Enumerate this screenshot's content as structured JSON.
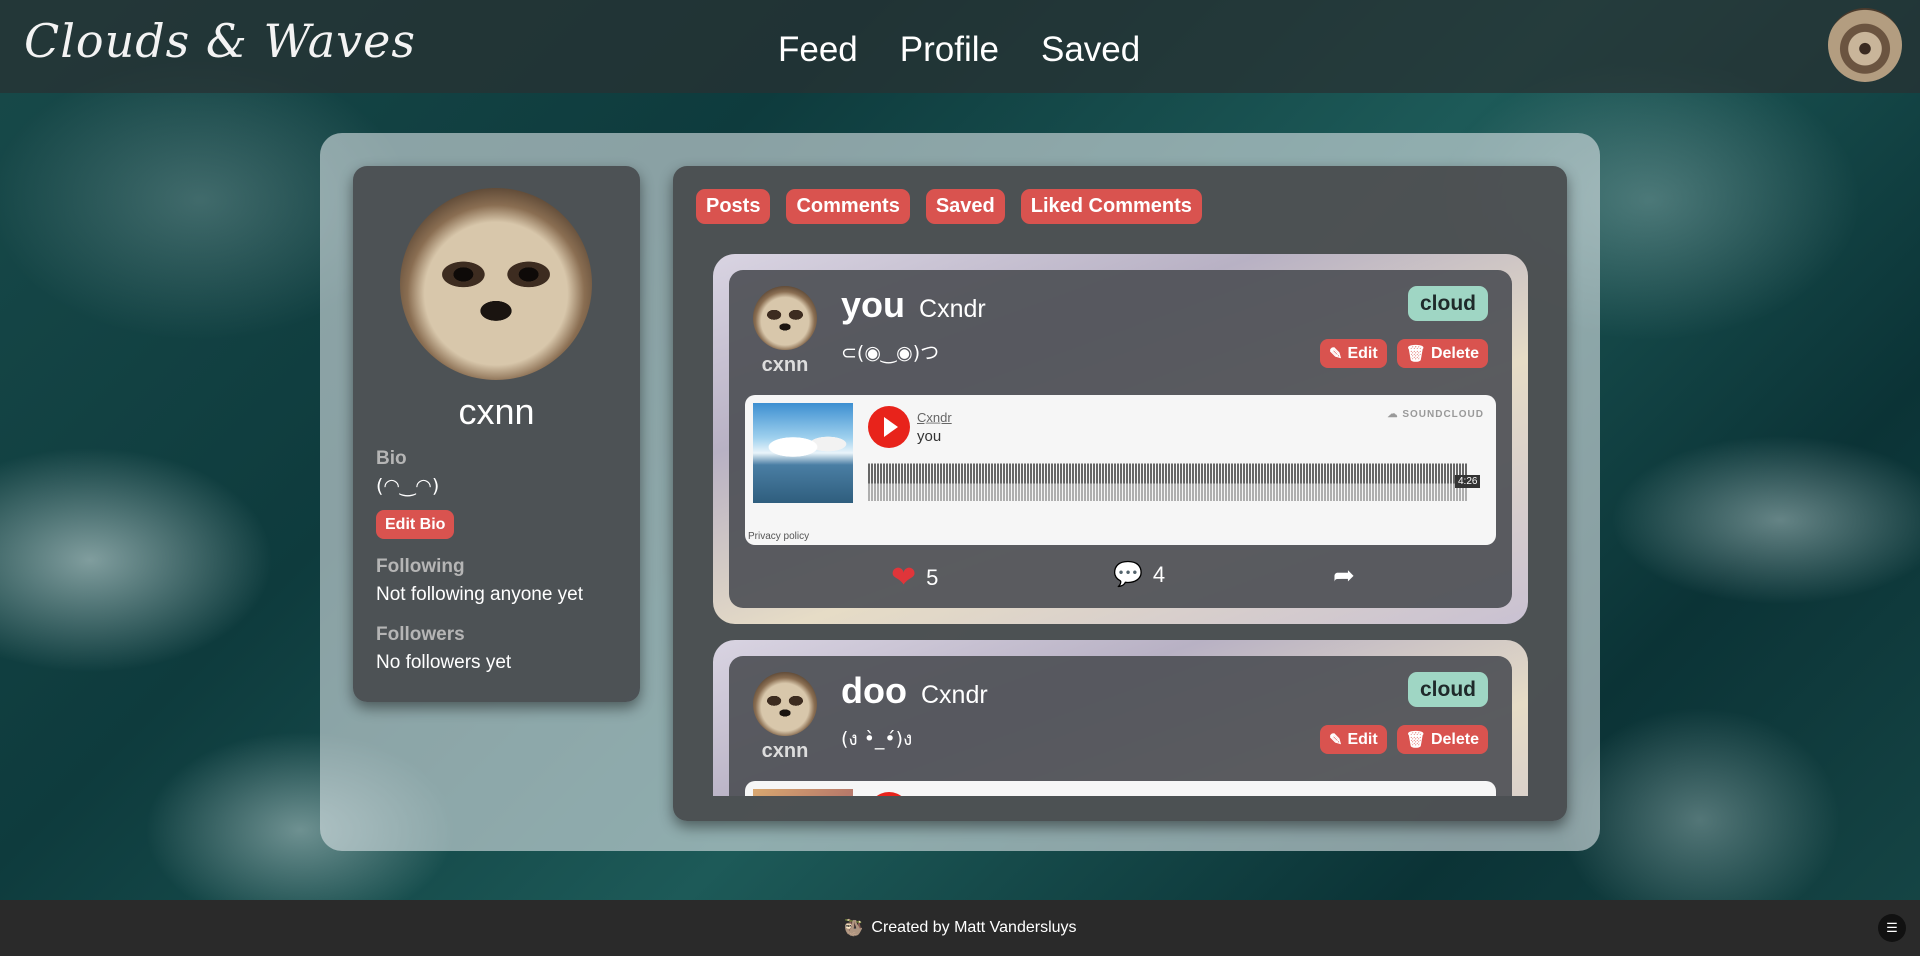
{
  "nav": {
    "brand": "Clouds & Waves",
    "links": [
      "Feed",
      "Profile",
      "Saved"
    ]
  },
  "profile": {
    "username": "cxnn",
    "bio_label": "Bio",
    "bio": "(◠‿◠)",
    "edit_bio_label": "Edit Bio",
    "following_label": "Following",
    "following_value": "Not following anyone yet",
    "followers_label": "Followers",
    "followers_value": "No followers yet"
  },
  "tabs": [
    "Posts",
    "Comments",
    "Saved",
    "Liked Comments"
  ],
  "posts": [
    {
      "title": "you",
      "artist": "Cxndr",
      "emote": "⊂(◉‿◉)つ",
      "user": "cxnn",
      "badge": "cloud",
      "edit_label": "Edit",
      "delete_label": "Delete",
      "widget": {
        "artist": "Cx̲n̲dr",
        "track": "you",
        "logo": "SOUNDCLOUD",
        "duration": "4:26",
        "privacy": "Privacy policy"
      },
      "likes": "5",
      "comments": "4"
    },
    {
      "title": "doo",
      "artist": "Cxndr",
      "emote": "(ง •̀_•́)ง",
      "user": "cxnn",
      "badge": "cloud",
      "edit_label": "Edit",
      "delete_label": "Delete"
    }
  ],
  "footer": {
    "text": "Created by Matt Vandersluys"
  },
  "colors": {
    "accent_red": "#d9534f",
    "badge_green": "#9fd6c4",
    "footer_bg": "#2a2a2a"
  }
}
